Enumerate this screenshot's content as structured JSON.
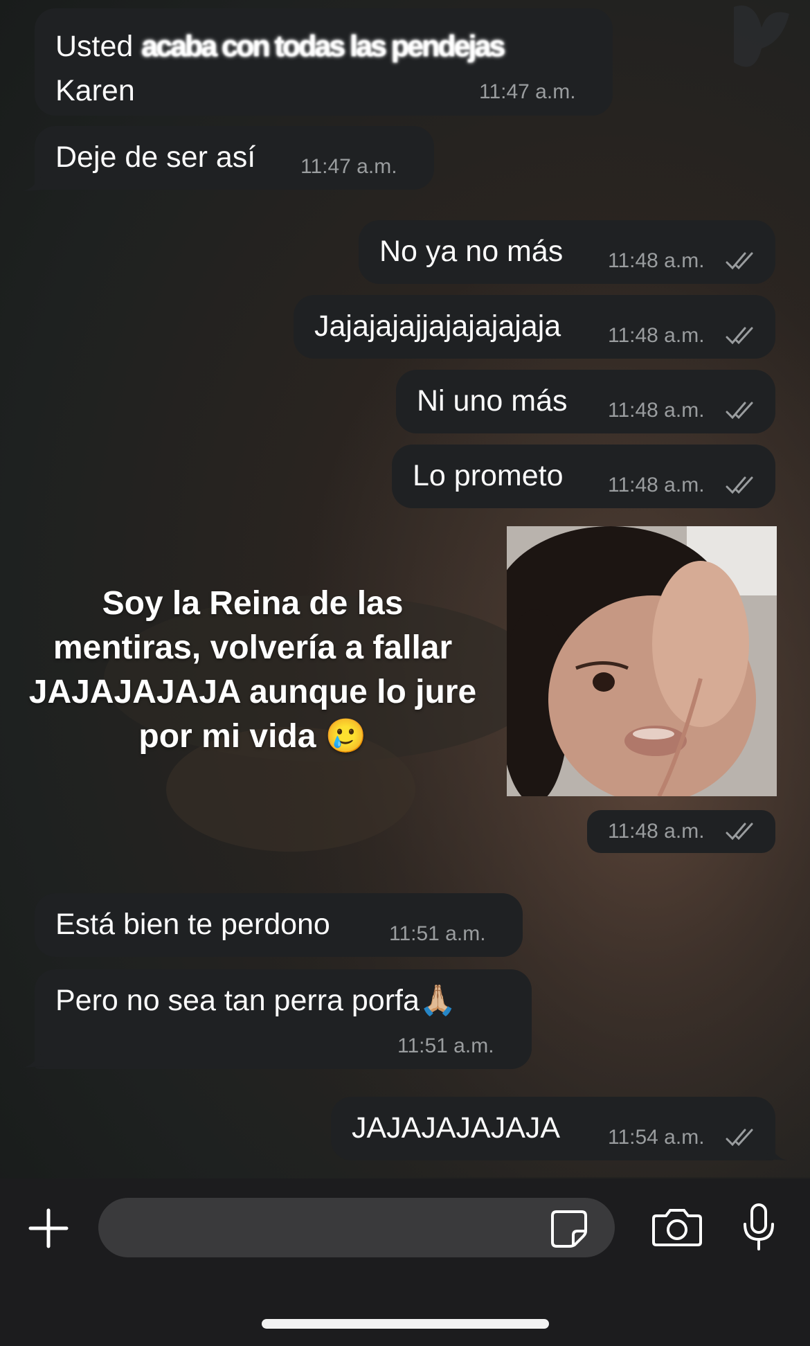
{
  "messages": [
    {
      "side": "in",
      "text_prefix": "Usted ",
      "text_redacted": "acaba con todas las pendejas",
      "text_line2": "Karen",
      "time": "11:47 a.m."
    },
    {
      "side": "in",
      "text": "Deje de ser así",
      "time": "11:47 a.m."
    },
    {
      "side": "out",
      "text": "No ya no más",
      "time": "11:48 a.m."
    },
    {
      "side": "out",
      "text": "Jajajajajjajajajajaja",
      "time": "11:48 a.m."
    },
    {
      "side": "out",
      "text": "Ni uno más",
      "time": "11:48 a.m."
    },
    {
      "side": "out",
      "text": "Lo prometo",
      "time": "11:48 a.m."
    },
    {
      "side": "out",
      "type": "image",
      "time": "11:48 a.m."
    },
    {
      "side": "in",
      "text": "Está bien te perdono",
      "time": "11:51 a.m."
    },
    {
      "side": "in",
      "text": "Pero no sea tan perra porfa",
      "emoji": "🙏🏼",
      "time": "11:51 a.m."
    },
    {
      "side": "out",
      "text": "JAJAJAJAJAJA",
      "time": "11:54 a.m."
    }
  ],
  "overlay_caption": "Soy la Reina de las mentiras, volvería a fallar JAJAJAJAJA aunque lo jure por mi vida",
  "overlay_emoji": "🥲",
  "composer": {
    "placeholder": "",
    "icons": [
      "plus-icon",
      "sticker-icon",
      "camera-icon",
      "microphone-icon"
    ]
  },
  "colors": {
    "bubble": "#1f2123",
    "time": "#9a9d9f",
    "bar": "#1c1c1e",
    "checks": "#9a9d9f"
  }
}
